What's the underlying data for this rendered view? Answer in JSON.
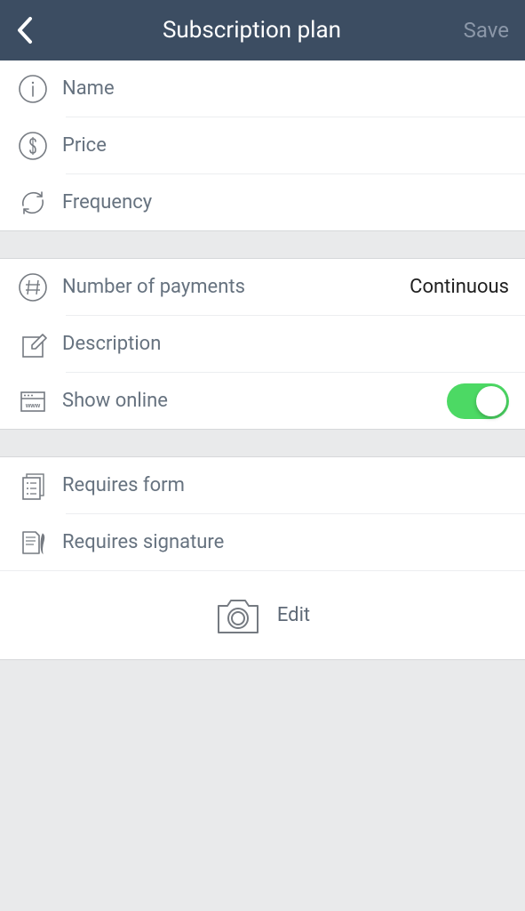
{
  "header": {
    "title": "Subscription plan",
    "save_label": "Save"
  },
  "section1": {
    "name_label": "Name",
    "price_label": "Price",
    "frequency_label": "Frequency"
  },
  "section2": {
    "number_payments_label": "Number of payments",
    "number_payments_value": "Continuous",
    "description_label": "Description",
    "show_online_label": "Show online"
  },
  "section3": {
    "requires_form_label": "Requires form",
    "requires_signature_label": "Requires signature"
  },
  "edit": {
    "label": "Edit"
  }
}
